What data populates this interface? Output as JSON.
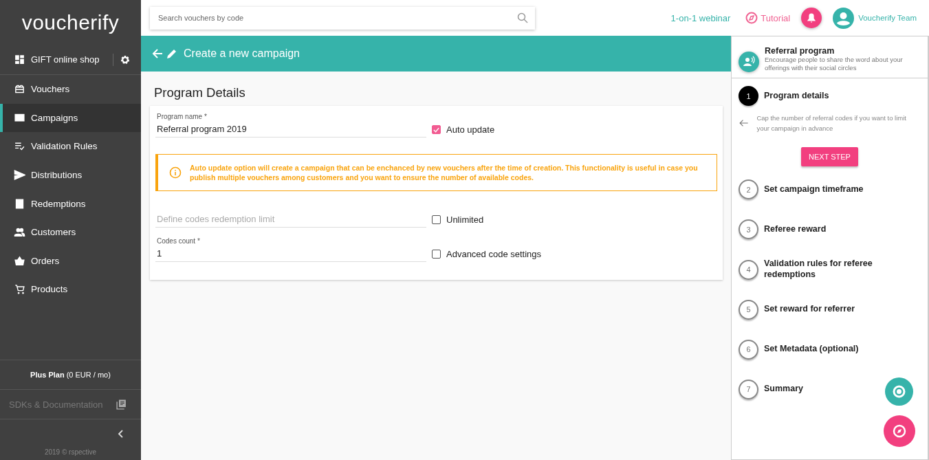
{
  "logo": {
    "text": "voucherify"
  },
  "sidebar": {
    "project": "GIFT online shop",
    "items": [
      {
        "label": "Vouchers",
        "selected": false
      },
      {
        "label": "Campaigns",
        "selected": true
      },
      {
        "label": "Validation Rules",
        "selected": false
      },
      {
        "label": "Distributions",
        "selected": false
      },
      {
        "label": "Redemptions",
        "selected": false
      },
      {
        "label": "Customers",
        "selected": false
      },
      {
        "label": "Orders",
        "selected": false
      },
      {
        "label": "Products",
        "selected": false
      }
    ],
    "plan": "**Plus Plan** (0 EUR / mo)",
    "docs": "SDKs & Documentation",
    "footer": "2019 © rspective"
  },
  "topbar": {
    "search_placeholder": "Search vouchers by code",
    "webinar": "1-on-1 webinar",
    "tutorial": "Tutorial",
    "user": "Voucherify Team"
  },
  "header": {
    "title": "Create a new campaign"
  },
  "form": {
    "title": "Program Details",
    "name_label": "Program name *",
    "name_value": "Referral program 2019",
    "auto_update": {
      "label": "Auto update",
      "checked": true
    },
    "alert": "Auto update option will create a campaign that can be enchanced by new vouchers after the time of creation. This functionality is useful in case you publish multiple vouchers among customers and you want to ensure the number of available codes.",
    "limit_placeholder": "Define codes redemption limit",
    "unlimited": {
      "label": "Unlimited",
      "checked": false
    },
    "count_label": "Codes count *",
    "count_value": "1",
    "advanced": {
      "label": "Advanced code settings",
      "checked": false
    }
  },
  "panel": {
    "title": "Referral program",
    "description": "Encourage people to share the word about your offerings with their social circles",
    "hint": "Cap the number of referral codes if you want to limit your campaign in advance",
    "next": "NEXT STEP",
    "steps": [
      {
        "number": "1",
        "label": "Program details",
        "selected": true
      },
      {
        "number": "2",
        "label": "Set campaign timeframe",
        "selected": false
      },
      {
        "number": "3",
        "label": "Referee reward",
        "selected": false
      },
      {
        "number": "4",
        "label": "Validation rules for referee redemptions",
        "selected": false
      },
      {
        "number": "5",
        "label": "Set reward for referrer",
        "selected": false
      },
      {
        "number": "6",
        "label": "Set Metadata (optional)",
        "selected": false
      },
      {
        "number": "7",
        "label": "Summary",
        "selected": false
      }
    ]
  }
}
